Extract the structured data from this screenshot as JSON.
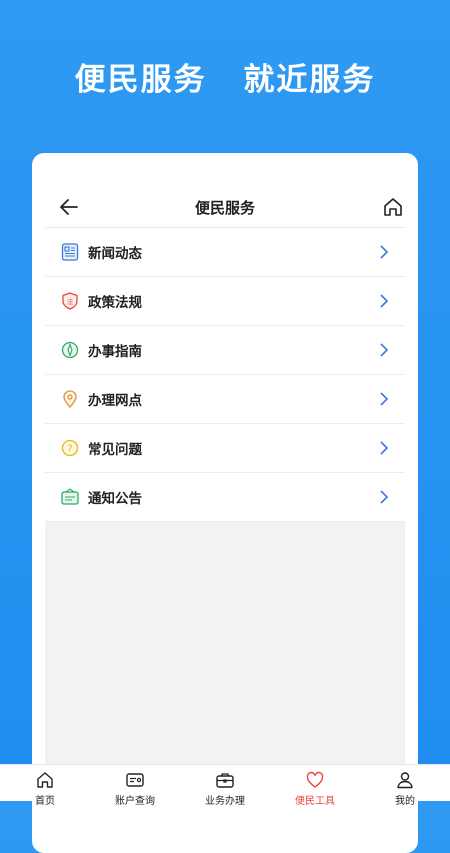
{
  "hero": {
    "left": "便民服务",
    "right": "就近服务"
  },
  "page": {
    "title": "便民服务"
  },
  "menu": [
    {
      "label": "新闻动态",
      "icon": "news-icon"
    },
    {
      "label": "政策法规",
      "icon": "law-shield-icon"
    },
    {
      "label": "办事指南",
      "icon": "compass-icon"
    },
    {
      "label": "办理网点",
      "icon": "location-pin-icon"
    },
    {
      "label": "常见问题",
      "icon": "question-icon"
    },
    {
      "label": "通知公告",
      "icon": "notice-icon"
    }
  ],
  "tabbar": {
    "items": [
      {
        "label": "首页",
        "icon": "home-icon"
      },
      {
        "label": "账户查询",
        "icon": "card-icon"
      },
      {
        "label": "业务办理",
        "icon": "briefcase-icon"
      },
      {
        "label": "便民工具",
        "icon": "heart-icon"
      },
      {
        "label": "我的",
        "icon": "user-icon"
      }
    ],
    "active": "便民工具"
  },
  "colors": {
    "background": "#2f9af2",
    "accent": "#e8483f",
    "chevron": "#3a78d8"
  }
}
